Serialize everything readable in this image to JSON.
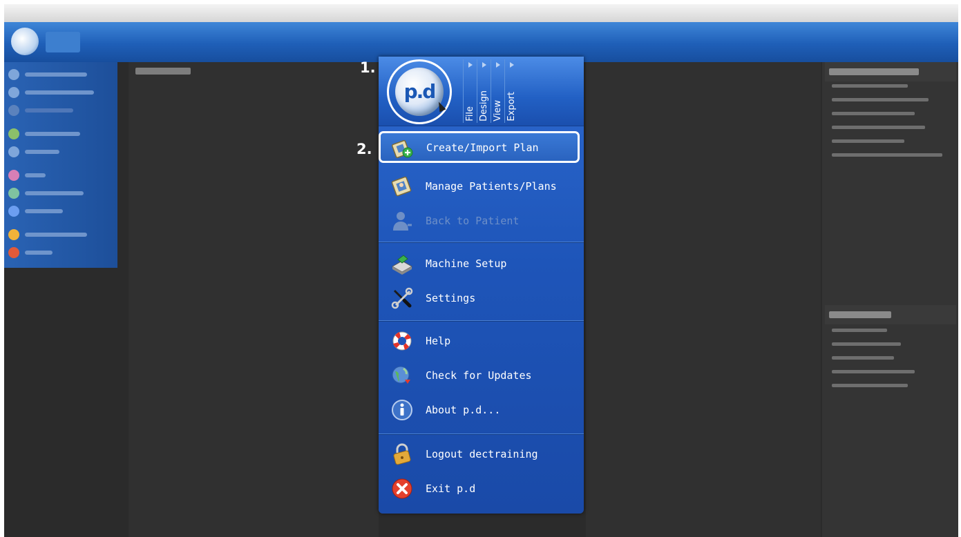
{
  "step_labels": {
    "step1": "1.",
    "step2": "2."
  },
  "menu": {
    "logo_text": "p.d",
    "tabs": [
      {
        "label": "File"
      },
      {
        "label": "Design"
      },
      {
        "label": "View"
      },
      {
        "label": "Export"
      }
    ],
    "items": [
      {
        "label": "Create/Import Plan",
        "icon": "create-plan-icon",
        "enabled": true,
        "highlighted": true
      },
      {
        "label": "Manage Patients/Plans",
        "icon": "manage-patients-icon",
        "enabled": true
      },
      {
        "label": "Back to Patient",
        "icon": "patient-icon",
        "enabled": false
      },
      {
        "label": "Machine Setup",
        "icon": "machine-setup-icon",
        "enabled": true
      },
      {
        "label": "Settings",
        "icon": "wrench-screwdriver-icon",
        "enabled": true
      },
      {
        "label": "Help",
        "icon": "lifebuoy-icon",
        "enabled": true
      },
      {
        "label": "Check for Updates",
        "icon": "globe-update-icon",
        "enabled": true
      },
      {
        "label": "About p.d...",
        "icon": "info-icon",
        "enabled": true
      },
      {
        "label": "Logout dectraining",
        "icon": "padlock-icon",
        "enabled": true
      },
      {
        "label": "Exit p.d",
        "icon": "close-icon",
        "enabled": true
      }
    ]
  },
  "colors": {
    "menu_blue": "#1e55b9",
    "background_dark": "#2b2b2b",
    "header_blue": "#1f5fb8"
  }
}
